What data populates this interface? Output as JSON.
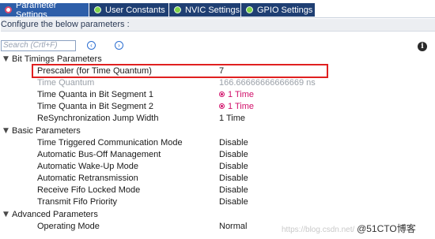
{
  "tabs": [
    {
      "label": "Parameter Settings",
      "active": true
    },
    {
      "label": "User Constants",
      "active": false
    },
    {
      "label": "NVIC Settings",
      "active": false
    },
    {
      "label": "GPIO Settings",
      "active": false
    }
  ],
  "subtitle": "Configure the below parameters :",
  "search": {
    "placeholder": "Search (Crtl+F)"
  },
  "nav": {
    "prev_glyph": "‹",
    "next_glyph": "›"
  },
  "info": {
    "glyph": "i"
  },
  "sections": {
    "bit_timings": {
      "label": "Bit Timings Parameters",
      "params": [
        {
          "name": "Prescaler (for Time Quantum)",
          "value": "7"
        },
        {
          "name": "Time Quantum",
          "value": "166.66666666666669 ns"
        },
        {
          "name": "Time Quanta in Bit Segment 1",
          "value": "1 Time"
        },
        {
          "name": "Time Quanta in Bit Segment 2",
          "value": "1 Time"
        },
        {
          "name": "ReSynchronization Jump Width",
          "value": "1 Time"
        }
      ]
    },
    "basic": {
      "label": "Basic Parameters",
      "params": [
        {
          "name": "Time Triggered Communication Mode",
          "value": "Disable"
        },
        {
          "name": "Automatic Bus-Off Management",
          "value": "Disable"
        },
        {
          "name": "Automatic Wake-Up Mode",
          "value": "Disable"
        },
        {
          "name": "Automatic Retransmission",
          "value": "Disable"
        },
        {
          "name": "Receive Fifo Locked Mode",
          "value": "Disable"
        },
        {
          "name": "Transmit Fifo Priority",
          "value": "Disable"
        }
      ]
    },
    "advanced": {
      "label": "Advanced Parameters",
      "params": [
        {
          "name": "Operating Mode",
          "value": "Normal"
        }
      ]
    }
  },
  "watermark": {
    "url": "https://blog.csdn.net/",
    "brand": "@51CTO博客"
  },
  "colors": {
    "tab_bg": "#1f3f73",
    "tab_active": "#2d5ea9",
    "highlight": "#e02020",
    "pink_value": "#d1106a"
  }
}
